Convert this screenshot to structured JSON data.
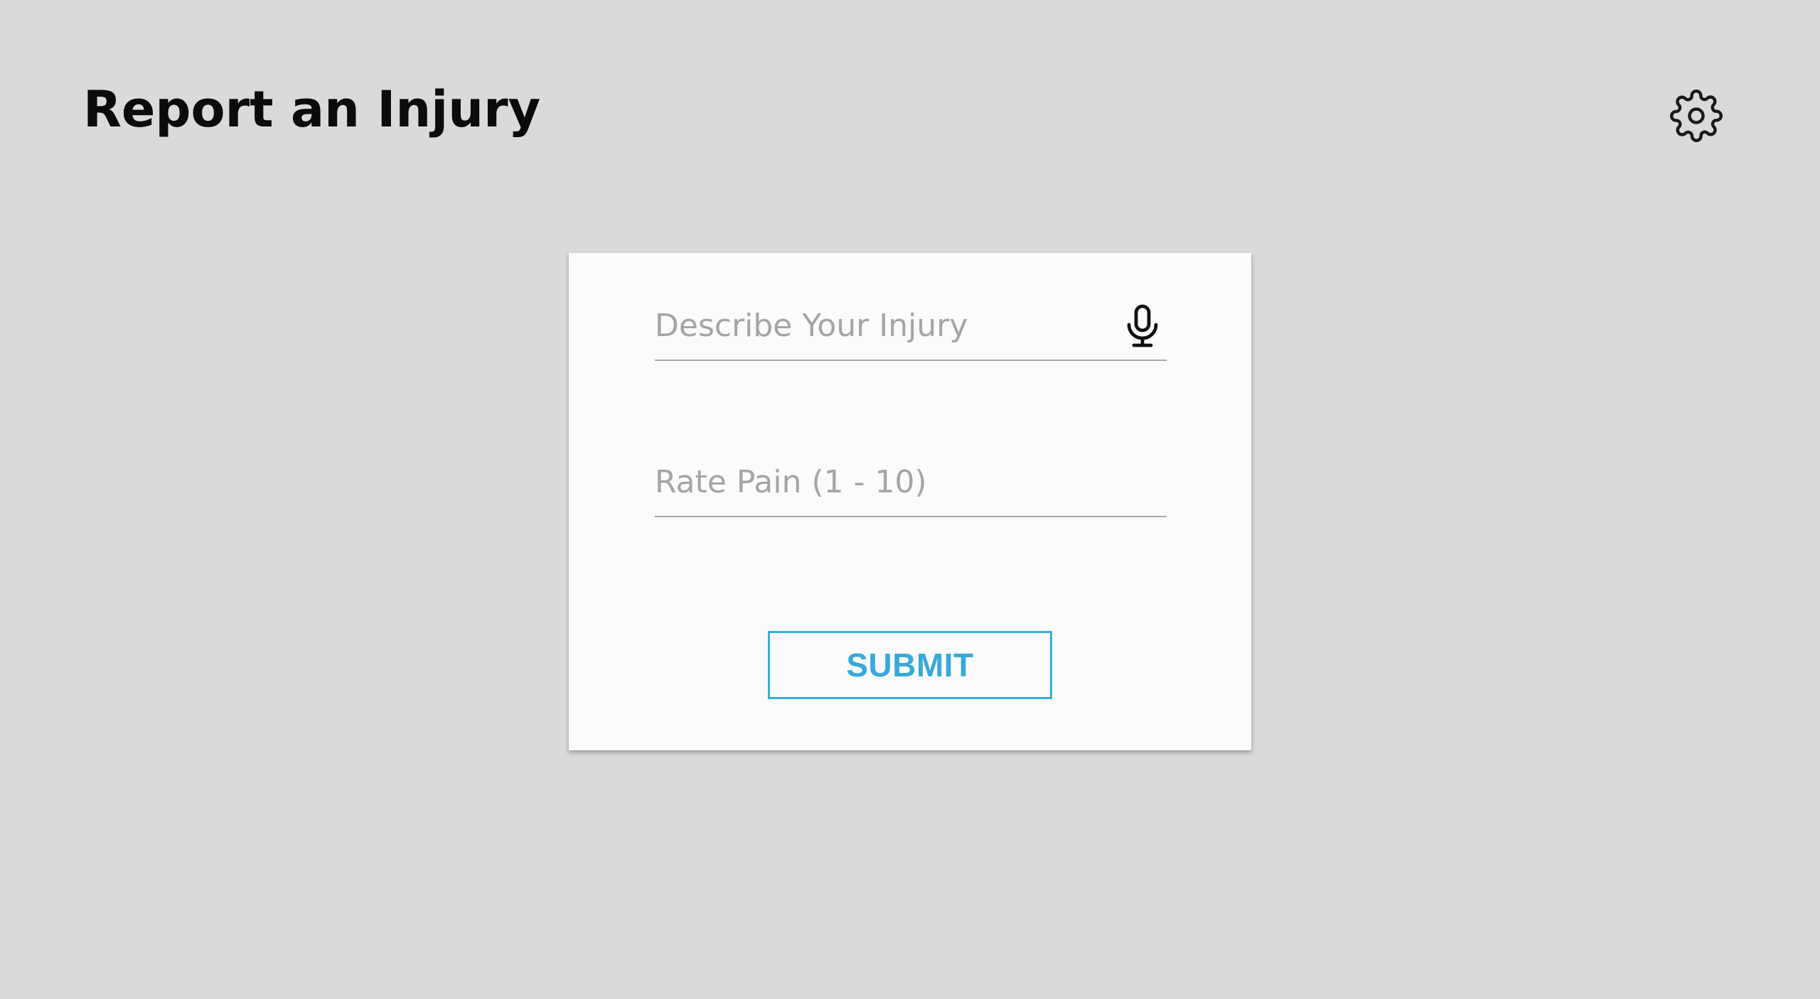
{
  "header": {
    "title": "Report an Injury",
    "settings_icon": "gear-icon"
  },
  "form": {
    "describe": {
      "value": "",
      "placeholder": "Describe Your Injury",
      "icon": "microphone-icon"
    },
    "pain": {
      "value": "",
      "placeholder": "Rate Pain (1 - 10)"
    },
    "submit_label": "SUBMIT"
  },
  "colors": {
    "background": "#d9dbda",
    "card": "#fbfbfb",
    "accent": "#38a9d9",
    "title": "#0b0b0b",
    "placeholder": "#a5a5a5"
  }
}
